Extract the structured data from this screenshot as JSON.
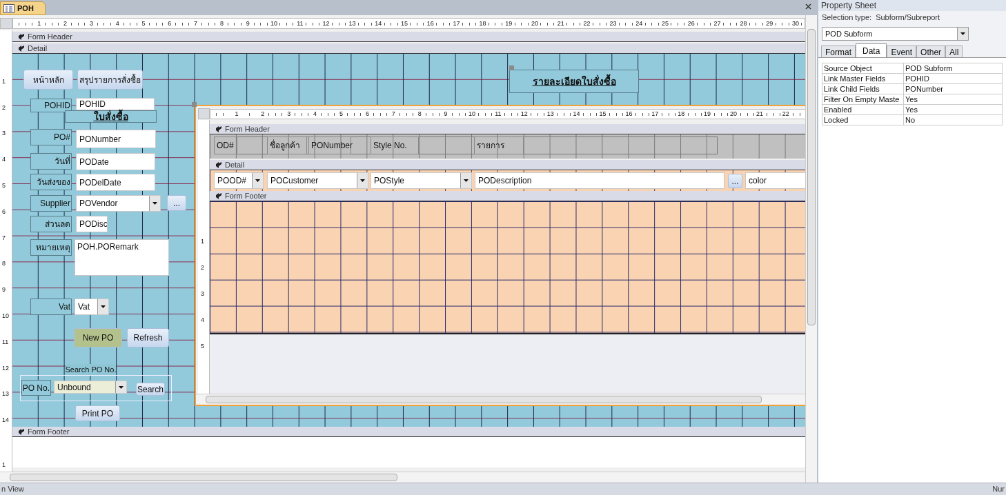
{
  "document_tab": {
    "title": "POH"
  },
  "ruler": {
    "numbers": [
      "1",
      "2",
      "3",
      "4",
      "5",
      "6",
      "7",
      "8",
      "9",
      "10",
      "11",
      "12",
      "13",
      "14",
      "15",
      "16",
      "17",
      "18",
      "19",
      "20",
      "21",
      "22",
      "23",
      "24",
      "25",
      "26",
      "27",
      "28",
      "29",
      "30"
    ]
  },
  "vertical_ruler": {
    "detail_numbers": [
      "1",
      "2",
      "3",
      "4",
      "5",
      "6",
      "7",
      "8",
      "9",
      "10",
      "11",
      "12",
      "13",
      "14"
    ],
    "footer_numbers": [
      "1"
    ]
  },
  "sections": {
    "header": "Form Header",
    "detail": "Detail",
    "footer": "Form Footer"
  },
  "detail_controls": [
    {
      "kind": "button",
      "text": "หน้าหลัก"
    },
    {
      "kind": "button",
      "text": "สรุปรายการสั่งซื้อ"
    },
    {
      "kind": "label",
      "text": "POHID"
    },
    {
      "kind": "textbox",
      "text": "POHID"
    },
    {
      "kind": "title",
      "text": "ใบสั่งซื้อ"
    },
    {
      "kind": "label",
      "text": "PO#"
    },
    {
      "kind": "textbox",
      "text": "PONumber"
    },
    {
      "kind": "label",
      "text": "วันที่"
    },
    {
      "kind": "textbox",
      "text": "PODate"
    },
    {
      "kind": "label",
      "text": "วันส่งของ"
    },
    {
      "kind": "textbox",
      "text": "PODelDate"
    },
    {
      "kind": "label",
      "text": "Supplier"
    },
    {
      "kind": "combo",
      "text": "POVendor"
    },
    {
      "kind": "button",
      "text": "..."
    },
    {
      "kind": "label",
      "text": "ส่วนลด"
    },
    {
      "kind": "textbox",
      "text": "PODisc"
    },
    {
      "kind": "label",
      "text": "หมายเหตุ"
    },
    {
      "kind": "memo",
      "text": "POH.PORemark"
    },
    {
      "kind": "label",
      "text": "Vat"
    },
    {
      "kind": "combo",
      "text": "Vat"
    },
    {
      "kind": "button",
      "text": "New PO"
    },
    {
      "kind": "button",
      "text": "Refresh"
    },
    {
      "kind": "caption",
      "text": "Search PO No."
    },
    {
      "kind": "label",
      "text": "PO No."
    },
    {
      "kind": "combo",
      "text": "Unbound"
    },
    {
      "kind": "button",
      "text": "Search"
    },
    {
      "kind": "button",
      "text": "Print PO"
    },
    {
      "kind": "title",
      "text": "รายละเอียดใบสั่งซื้อ"
    }
  ],
  "subform": {
    "ruler_numbers": [
      "1",
      "2",
      "3",
      "4",
      "5",
      "6",
      "7",
      "8",
      "9",
      "10",
      "11",
      "12",
      "13",
      "14",
      "15",
      "16",
      "17",
      "18",
      "19",
      "20",
      "21",
      "22"
    ],
    "vertical_ruler_numbers": [
      "1",
      "2",
      "3",
      "4",
      "5"
    ],
    "sections": {
      "header": "Form Header",
      "detail": "Detail",
      "footer": "Form Footer"
    },
    "header_labels": [
      "OD#",
      "ชื่อลูกค้า",
      "PONumber",
      "Style No.",
      "รายการ"
    ],
    "detail_controls": [
      {
        "kind": "combo",
        "text": "POOD#"
      },
      {
        "kind": "combo",
        "text": "POCustomer"
      },
      {
        "kind": "combo",
        "text": "POStyle"
      },
      {
        "kind": "textbox",
        "text": "PODescription"
      },
      {
        "kind": "button",
        "text": "..."
      },
      {
        "kind": "textbox",
        "text": "color"
      }
    ]
  },
  "property_sheet": {
    "title": "Property Sheet",
    "selection_type_label": "Selection type:",
    "selection_type": "Subform/Subreport",
    "object": "POD Subform",
    "tabs": [
      {
        "label": "Format",
        "selected": false
      },
      {
        "label": "Data",
        "selected": true
      },
      {
        "label": "Event",
        "selected": false
      },
      {
        "label": "Other",
        "selected": false
      },
      {
        "label": "All",
        "selected": false
      }
    ],
    "rows": [
      {
        "name": "Source Object",
        "value": "POD Subform"
      },
      {
        "name": "Link Master Fields",
        "value": "POHID"
      },
      {
        "name": "Link Child Fields",
        "value": "PONumber"
      },
      {
        "name": "Filter On Empty Maste",
        "value": "Yes"
      },
      {
        "name": "Enabled",
        "value": "Yes"
      },
      {
        "name": "Locked",
        "value": "No"
      }
    ]
  },
  "status_bar": {
    "left": "n View",
    "right": "Nur"
  }
}
